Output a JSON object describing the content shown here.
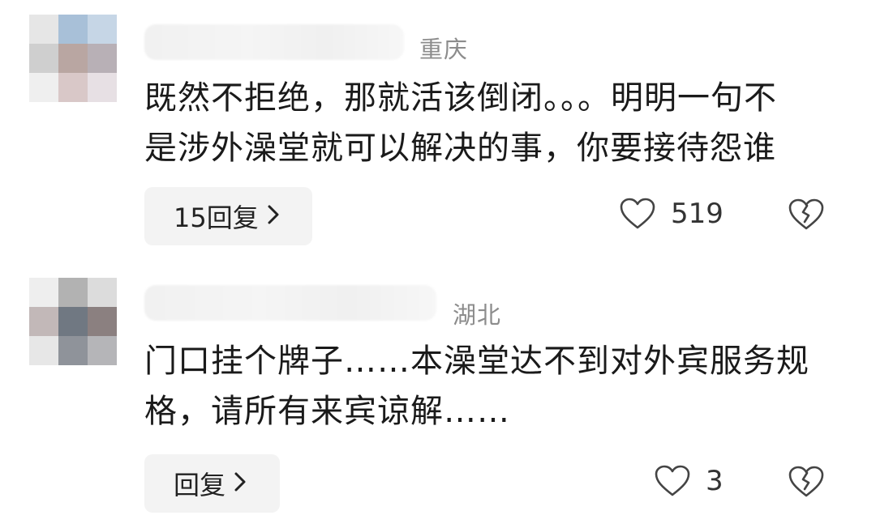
{
  "comments": [
    {
      "location": "重庆",
      "text": "既然不拒绝，那就活该倒闭。。。明明一句不\n是涉外澡堂就可以解决的事，你要接待怨谁",
      "reply_label": "15回复",
      "like_count": "519",
      "avatar_colors": [
        "#e6e6e6",
        "#a8c0d8",
        "#c6d6e6",
        "#cfcfcf",
        "#b9a6a2",
        "#b8b0b6",
        "#efefef",
        "#d9c8c8",
        "#e7e0e4"
      ]
    },
    {
      "location": "湖北",
      "text": "门口挂个牌子……本澡堂达不到对外宾服务规\n格，请所有来宾谅解……",
      "reply_label": "回复",
      "like_count": "3",
      "avatar_colors": [
        "#eeeeee",
        "#b2b2b2",
        "#dcdcdc",
        "#c2b8b8",
        "#707882",
        "#8b8080",
        "#e7e7e7",
        "#8f939a",
        "#b5b5b8"
      ]
    }
  ],
  "icons": {
    "like": "heart-outline-icon",
    "dislike": "broken-heart-icon",
    "chevron": "chevron-right-icon"
  }
}
